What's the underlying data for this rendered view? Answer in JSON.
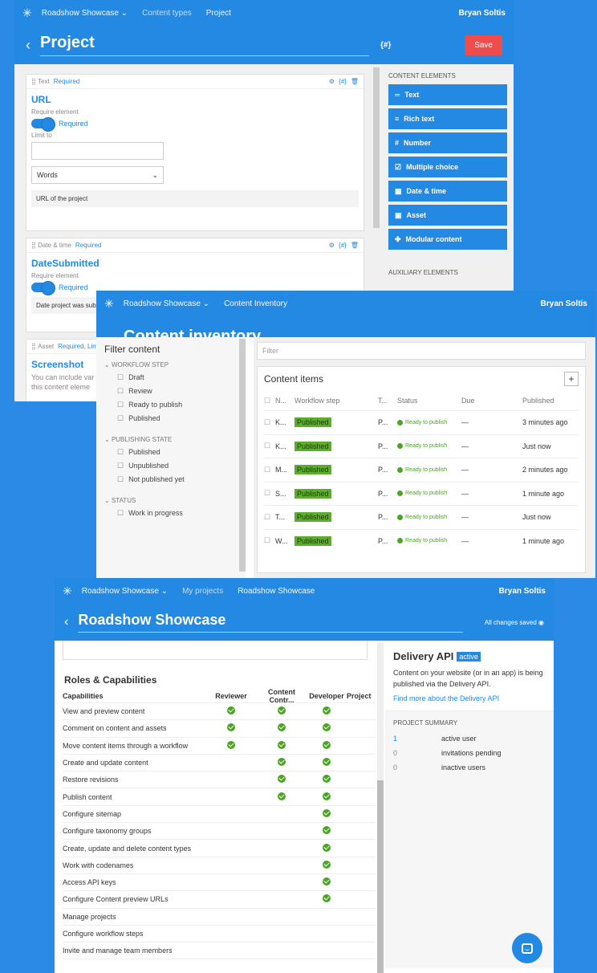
{
  "project_window": {
    "topbar": {
      "project_menu": "Roadshow Showcase",
      "crumb1": "Content types",
      "crumb2": "Project",
      "user": "Bryan Soltis"
    },
    "title": "Project",
    "codename_label": "{#}",
    "save_label": "Save",
    "elements": [
      {
        "type": "Text",
        "required": "Required",
        "name": "URL",
        "require_label": "Require element",
        "toggle": "Required",
        "limit_label": "Limit to",
        "limit_unit": "Words",
        "guidelines": "URL of the project"
      },
      {
        "type": "Date & time",
        "required": "Required",
        "name": "DateSubmitted",
        "require_label": "Require element",
        "toggle": "Required",
        "guidelines": "Date project was sub"
      },
      {
        "type": "Asset",
        "required": "Required, Lim",
        "name": "Screenshot",
        "desc1": "You can include var",
        "desc2": "this content eleme"
      }
    ],
    "panel": {
      "section": "CONTENT ELEMENTS",
      "buttons": [
        "Text",
        "Rich text",
        "Number",
        "Multiple choice",
        "Date & time",
        "Asset",
        "Modular content"
      ],
      "aux": "AUXILIARY ELEMENTS"
    }
  },
  "inventory_window": {
    "topbar": {
      "project_menu": "Roadshow Showcase",
      "crumb1": "Content Inventory",
      "user": "Bryan Soltis"
    },
    "title": "Content inventory",
    "filter": {
      "title": "Filter content",
      "workflow_step": "WORKFLOW STEP",
      "workflow_items": [
        "Draft",
        "Review",
        "Ready to publish",
        "Published"
      ],
      "publishing_state": "PUBLISHING STATE",
      "publishing_items": [
        "Published",
        "Unpublished",
        "Not published yet"
      ],
      "status": "STATUS",
      "status_items": [
        "Work in progress"
      ]
    },
    "search_placeholder": "Filter",
    "list_title": "Content items",
    "columns": [
      "N...",
      "Workflow step",
      "T...",
      "Status",
      "Due",
      "Published"
    ],
    "rows": [
      {
        "name": "K...",
        "step": "Published",
        "type": "P...",
        "status": "Ready to publish",
        "due": "—",
        "published": "3 minutes ago"
      },
      {
        "name": "K...",
        "step": "Published",
        "type": "P...",
        "status": "Ready to publish",
        "due": "—",
        "published": "Just now"
      },
      {
        "name": "M...",
        "step": "Published",
        "type": "P...",
        "status": "Ready to publish",
        "due": "—",
        "published": "2 minutes ago"
      },
      {
        "name": "S...",
        "step": "Published",
        "type": "P...",
        "status": "Ready to publish",
        "due": "—",
        "published": "1 minute ago"
      },
      {
        "name": "T...",
        "step": "Published",
        "type": "P...",
        "status": "Ready to publish",
        "due": "—",
        "published": "Just now"
      },
      {
        "name": "W...",
        "step": "Published",
        "type": "P...",
        "status": "Ready to publish",
        "due": "—",
        "published": "1 minute ago"
      }
    ]
  },
  "project_settings_window": {
    "topbar": {
      "project_menu": "Roadshow Showcase",
      "crumb1": "My projects",
      "crumb2": "Roadshow Showcase",
      "user": "Bryan Soltis"
    },
    "title": "Roadshow Showcase",
    "saved_status": "All changes saved",
    "roles_title": "Roles & Capabilities",
    "cap_headers": [
      "Capabilities",
      "Reviewer",
      "Content Contr...",
      "Developer",
      "Project"
    ],
    "capabilities": [
      {
        "name": "View and preview content",
        "r": true,
        "c": true,
        "d": true
      },
      {
        "name": "Comment on content and assets",
        "r": true,
        "c": true,
        "d": true
      },
      {
        "name": "Move content items through a workflow",
        "r": true,
        "c": true,
        "d": true
      },
      {
        "name": "Create and update content",
        "r": false,
        "c": true,
        "d": true
      },
      {
        "name": "Restore revisions",
        "r": false,
        "c": true,
        "d": true
      },
      {
        "name": "Publish content",
        "r": false,
        "c": true,
        "d": true
      },
      {
        "name": "Configure sitemap",
        "r": false,
        "c": false,
        "d": true
      },
      {
        "name": "Configure taxonomy groups",
        "r": false,
        "c": false,
        "d": true
      },
      {
        "name": "Create, update and delete content types",
        "r": false,
        "c": false,
        "d": true
      },
      {
        "name": "Work with codenames",
        "r": false,
        "c": false,
        "d": true
      },
      {
        "name": "Access API keys",
        "r": false,
        "c": false,
        "d": true
      },
      {
        "name": "Configure Content preview URLs",
        "r": false,
        "c": false,
        "d": true
      },
      {
        "name": "Manage projects",
        "r": false,
        "c": false,
        "d": false
      },
      {
        "name": "Configure workflow steps",
        "r": false,
        "c": false,
        "d": false
      },
      {
        "name": "Invite and manage team members",
        "r": false,
        "c": false,
        "d": false
      }
    ],
    "api": {
      "title": "Delivery API",
      "badge": "active",
      "desc": "Content on your website (or in an app) is being published via the Delivery API.",
      "link": "Find more about the Delivery API"
    },
    "summary": {
      "title": "PROJECT SUMMARY",
      "rows": [
        {
          "n": "1",
          "label": "active user"
        },
        {
          "n": "0",
          "label": "invitations pending"
        },
        {
          "n": "0",
          "label": "inactive users"
        }
      ]
    }
  },
  "colors": {
    "brand_blue": "#2489e3",
    "save_red": "#ef4d4d",
    "published_green": "#5dab2f",
    "check_green": "#4aa523"
  }
}
